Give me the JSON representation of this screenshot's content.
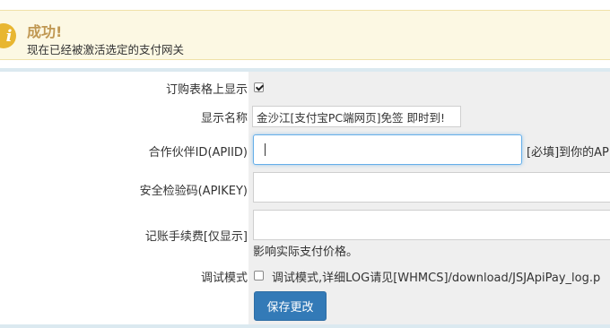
{
  "alert": {
    "icon": "info-icon",
    "title": "成功!",
    "message": "现在已经被激活选定的支付网关"
  },
  "form": {
    "show_on_order": {
      "label": "订购表格上显示",
      "checked": true
    },
    "display_name": {
      "label": "显示名称",
      "value": "金沙江[支付宝PC端网页]免签 即时到!"
    },
    "partner_id": {
      "label": "合作伙伴ID(APIID)",
      "value": "",
      "hint": "[必填]到你的AP"
    },
    "security_key": {
      "label": "安全检验码(APIKEY)",
      "value": ""
    },
    "fee": {
      "label": "记账手续费[仅显示]",
      "value": "",
      "hint": "影响实际支付价格。"
    },
    "debug_mode": {
      "label": "调试模式",
      "checked": false,
      "description": "调试模式,详细LOG请见[WHMCS]/download/JSJApiPay_log.p"
    },
    "save_button": "保存更改"
  },
  "colors": {
    "alert_bg": "#fcf8e3",
    "alert_title": "#c09853",
    "primary_button": "#337ab7",
    "field_bg": "#efefef"
  }
}
